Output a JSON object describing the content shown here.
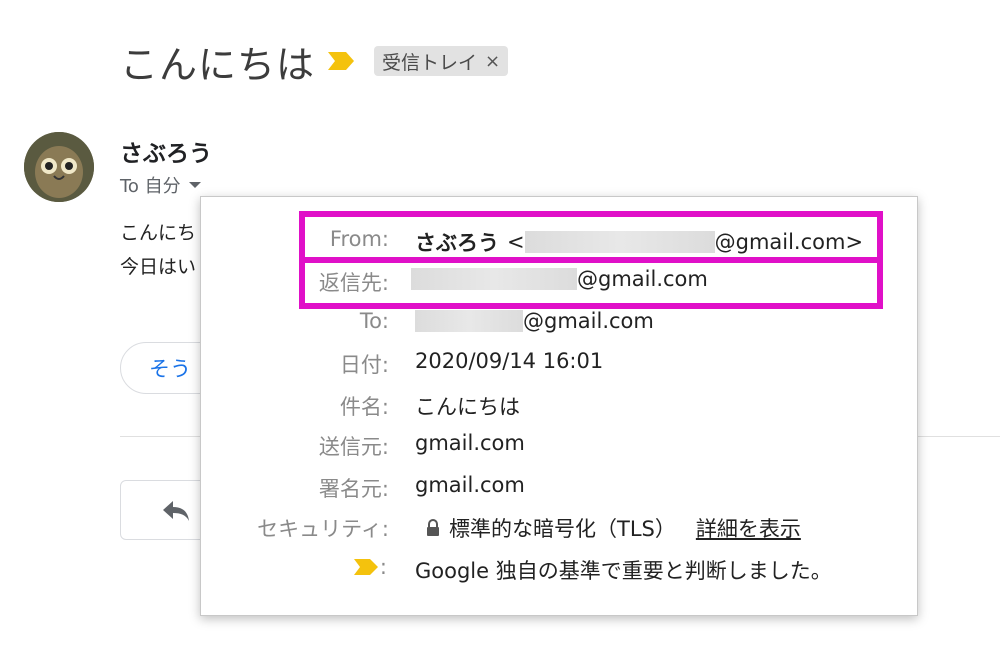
{
  "subject": "こんにちは",
  "label_chip": {
    "text": "受信トレイ",
    "close": "×"
  },
  "sender": {
    "name": "さぶろう",
    "to_label": "To 自分"
  },
  "body": {
    "line1": "こんにち",
    "line2": "今日はい"
  },
  "reply_suggestion": "そう",
  "details": {
    "from": {
      "label": "From:",
      "name": "さぶろう",
      "open": "<",
      "email_suffix": "@gmail.com>"
    },
    "reply_to": {
      "label": "返信先:",
      "email_suffix": "@gmail.com"
    },
    "to": {
      "label": "To:",
      "email_suffix": "@gmail.com"
    },
    "date": {
      "label": "日付:",
      "value": "2020/09/14 16:01"
    },
    "subject": {
      "label": "件名:",
      "value": "こんにちは"
    },
    "mailed_by": {
      "label": "送信元:",
      "value": "gmail.com"
    },
    "signed_by": {
      "label": "署名元:",
      "value": "gmail.com"
    },
    "security": {
      "label": "セキュリティ:",
      "value": "標準的な暗号化（TLS）",
      "link": "詳細を表示"
    },
    "importance": {
      "label": ":",
      "value": "Google 独自の基準で重要と判断しました。"
    }
  },
  "colors": {
    "highlight": "#e010c8",
    "importance_marker": "#f4c20d",
    "link_blue": "#1a73e8"
  },
  "icons": [
    "importance-marker-icon",
    "close-icon",
    "dropdown-caret-icon",
    "lock-icon",
    "reply-icon"
  ]
}
